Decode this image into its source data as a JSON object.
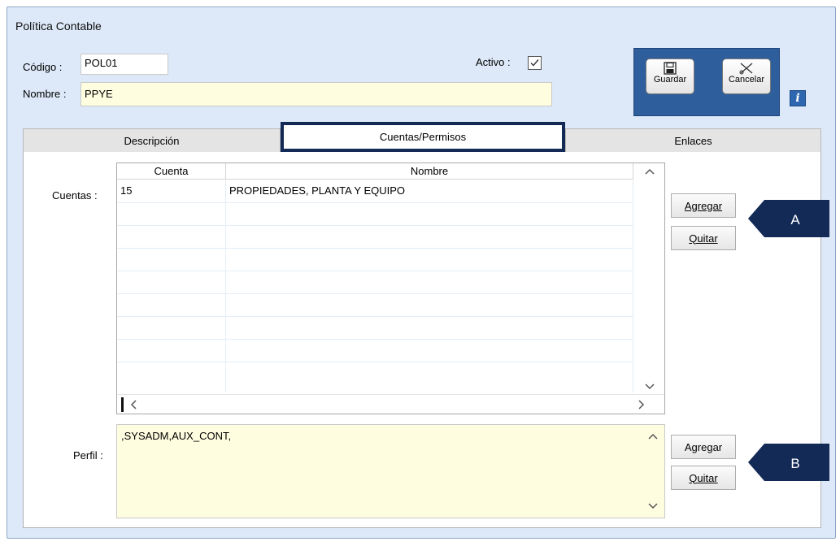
{
  "window": {
    "title": "Política Contable"
  },
  "header": {
    "codigo_label": "Código :",
    "codigo_value": "POL01",
    "nombre_label": "Nombre :",
    "nombre_value": "PPYE",
    "activo_label": "Activo :",
    "activo_checked": true
  },
  "toolbar": {
    "guardar_label": "Guardar",
    "cancelar_label": "Cancelar"
  },
  "tabs": [
    {
      "label": "Descripción",
      "active": false
    },
    {
      "label": "Cuentas/Permisos",
      "active": true
    },
    {
      "label": "Enlaces",
      "active": false
    }
  ],
  "cuentas": {
    "label": "Cuentas :",
    "columns": [
      "Cuenta",
      "Nombre"
    ],
    "rows": [
      {
        "cuenta": "15",
        "nombre": "PROPIEDADES, PLANTA Y EQUIPO"
      }
    ],
    "agregar_label": "Agregar",
    "quitar_label": "Quitar"
  },
  "perfil": {
    "label": "Perfil :",
    "value": ",SYSADM,AUX_CONT,",
    "agregar_label": "Agregar",
    "quitar_label": "Quitar"
  },
  "callouts": {
    "a": "A",
    "b": "B"
  },
  "colors": {
    "toolbar_bg": "#2f5e9c",
    "callout_bg": "#132a56",
    "field_yellow": "#fffde0"
  },
  "icons": {
    "guardar": "floppy-disk-icon",
    "cancelar": "scissors-cross-icon",
    "info": "info-icon",
    "check": "check-icon"
  }
}
